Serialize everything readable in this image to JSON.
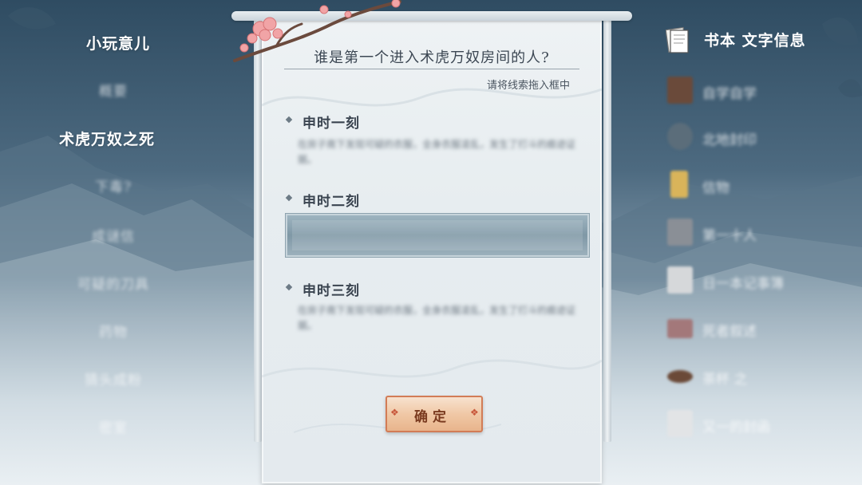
{
  "left_menu": {
    "items": [
      {
        "label": "小玩意儿",
        "state": "active"
      },
      {
        "label": "概要",
        "state": "blurred"
      },
      {
        "label": "术虎万奴之死",
        "state": "active"
      },
      {
        "label": "下毒?",
        "state": "blurred"
      },
      {
        "label": "成谜信",
        "state": "blurred"
      },
      {
        "label": "可疑的刀具",
        "state": "blurred"
      },
      {
        "label": "药物",
        "state": "blurred"
      },
      {
        "label": "猜头成粉",
        "state": "blurred"
      },
      {
        "label": "密室",
        "state": "blurred"
      }
    ]
  },
  "right_panel": {
    "header": "书本 文字信息",
    "items": [
      {
        "label": "自学自学",
        "color": "#6a4a3a"
      },
      {
        "label": "北地封印",
        "color": "#5b6d7a"
      },
      {
        "label": "信物",
        "color": "#d9b45a"
      },
      {
        "label": "第一十人",
        "color": "#8a8f96"
      },
      {
        "label": "日一本记事簿",
        "color": "#d6d8da"
      },
      {
        "label": "死者叙述",
        "color": "#a3787a"
      },
      {
        "label": "茶杯 之",
        "color": "#6b4a38"
      },
      {
        "label": "又一的封函",
        "color": "#e2e4e6"
      }
    ]
  },
  "scroll": {
    "question": "谁是第一个进入术虎万奴房间的人?",
    "hint": "请将线索拖入框中",
    "sections": [
      {
        "title": "申时一刻",
        "body": "在房子南下发现可疑的衣服，全身衣服凌乱，发生了打斗的痕迹证据。"
      },
      {
        "title": "申时二刻",
        "body": ""
      },
      {
        "title": "申时三刻",
        "body": "在房子南下发现可疑的衣服，全身衣服凌乱，发生了打斗的痕迹证据。"
      }
    ],
    "confirm_label": "确定"
  },
  "colors": {
    "accent_button": "#e8b48c",
    "button_border": "#d27c56",
    "slot": "#8ea3af"
  }
}
